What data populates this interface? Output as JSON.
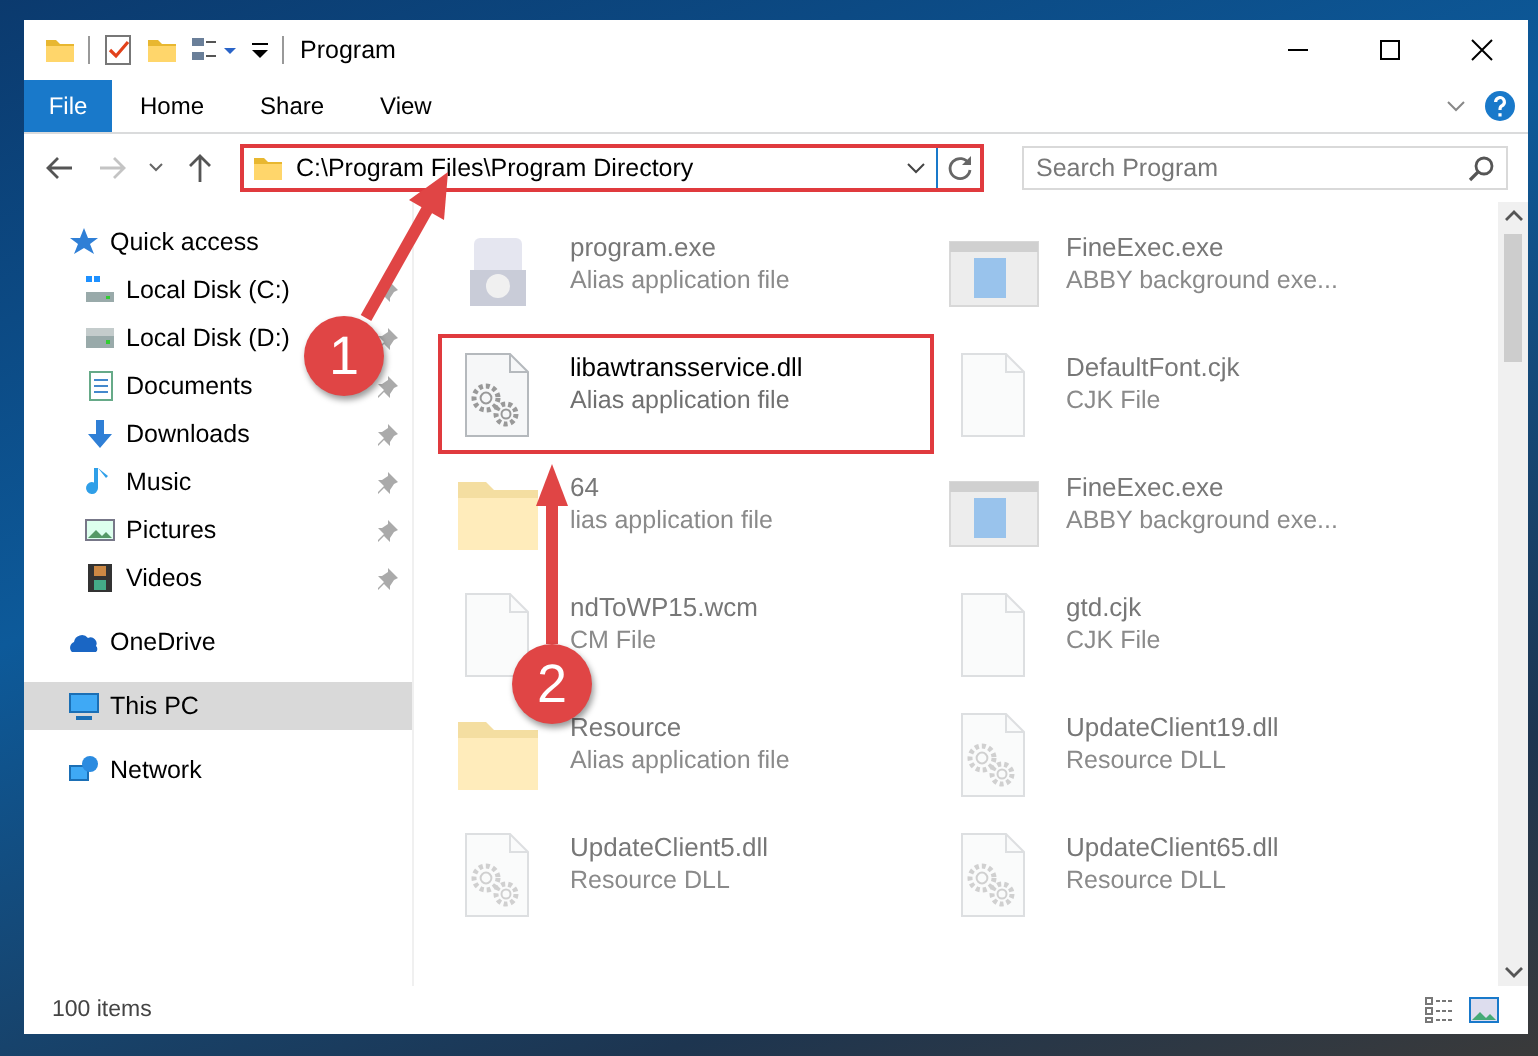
{
  "window": {
    "title": "Program"
  },
  "ribbon": {
    "tabs": [
      {
        "label": "File",
        "kind": "file"
      },
      {
        "label": "Home",
        "kind": "tab"
      },
      {
        "label": "Share",
        "kind": "tab"
      },
      {
        "label": "View",
        "kind": "tab"
      }
    ]
  },
  "address": {
    "path": "C:\\Program Files\\Program Directory",
    "highlighted": true
  },
  "search": {
    "placeholder": "Search Program"
  },
  "nav": [
    {
      "label": "Quick access",
      "kind": "quick",
      "selected": false,
      "children": [
        {
          "label": "Local Disk (C:)",
          "kind": "drive-c",
          "pinned": true
        },
        {
          "label": "Local Disk (D:)",
          "kind": "drive",
          "pinned": true
        },
        {
          "label": "Documents",
          "kind": "documents",
          "pinned": true
        },
        {
          "label": "Downloads",
          "kind": "downloads",
          "pinned": true
        },
        {
          "label": "Music",
          "kind": "music",
          "pinned": true
        },
        {
          "label": "Pictures",
          "kind": "pictures",
          "pinned": true
        },
        {
          "label": "Videos",
          "kind": "videos",
          "pinned": true
        }
      ]
    },
    {
      "label": "OneDrive",
      "kind": "cloud",
      "selected": false
    },
    {
      "label": "This PC",
      "kind": "pc",
      "selected": true
    },
    {
      "label": "Network",
      "kind": "network",
      "selected": false
    }
  ],
  "files": [
    {
      "name": "program.exe",
      "type": "Alias application file",
      "kind": "exe",
      "highlighted": false
    },
    {
      "name": "FineExec.exe",
      "type": "ABBY background exe...",
      "kind": "app",
      "highlighted": false
    },
    {
      "name": "libawtransservice.dll",
      "type": "Alias application file",
      "kind": "dll",
      "highlighted": true
    },
    {
      "name": "DefaultFont.cjk",
      "type": "CJK File",
      "kind": "doc",
      "highlighted": false
    },
    {
      "name": "64",
      "type": "lias application file",
      "kind": "folder",
      "highlighted": false
    },
    {
      "name": "FineExec.exe",
      "type": "ABBY background exe...",
      "kind": "app",
      "highlighted": false
    },
    {
      "name": "ndToWP15.wcm",
      "type": "CM File",
      "kind": "doc",
      "highlighted": false
    },
    {
      "name": "gtd.cjk",
      "type": "CJK File",
      "kind": "doc",
      "highlighted": false
    },
    {
      "name": "Resource",
      "type": "Alias application file",
      "kind": "folder",
      "highlighted": false
    },
    {
      "name": "UpdateClient19.dll",
      "type": "Resource DLL",
      "kind": "dll",
      "highlighted": false
    },
    {
      "name": "UpdateClient5.dll",
      "type": "Resource DLL",
      "kind": "dll",
      "highlighted": false
    },
    {
      "name": "UpdateClient65.dll",
      "type": "Resource DLL",
      "kind": "dll",
      "highlighted": false
    }
  ],
  "status": {
    "count": "100 items"
  },
  "callouts": [
    {
      "number": "1"
    },
    {
      "number": "2"
    }
  ]
}
